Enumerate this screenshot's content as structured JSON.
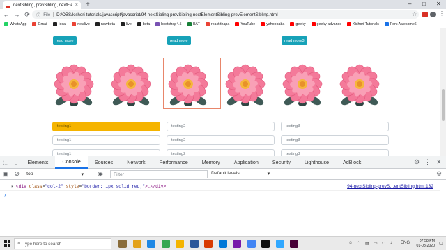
{
  "browser": {
    "tab_title": "nextSibling, prevSibling, nextEle",
    "tab_close": "×",
    "new_tab": "+",
    "minimize": "–",
    "maximize": "□",
    "close": "✕",
    "file_label": "File",
    "url": "D:/OBS/kishori-tutorials/javascript/javascript/94-nextSibling-prevSibling-nextElementSibling-prevElementSibling.html"
  },
  "bookmarks": [
    {
      "label": "WhatsApp",
      "color": "#25d366"
    },
    {
      "label": "Gmail",
      "color": "#ea4335"
    },
    {
      "label": "local",
      "color": "#222222"
    },
    {
      "label": "newlive",
      "color": "#ea4335"
    },
    {
      "label": "newbeta",
      "color": "#222222"
    },
    {
      "label": "live",
      "color": "#222222"
    },
    {
      "label": "beta",
      "color": "#222222"
    },
    {
      "label": "bootstrap4.5",
      "color": "#7952b3"
    },
    {
      "label": "UAT",
      "color": "#188038"
    },
    {
      "label": "react thapa",
      "color": "#ea4335"
    },
    {
      "label": "YouTube",
      "color": "#ff0000"
    },
    {
      "label": "yahoobaba",
      "color": "#ff0000"
    },
    {
      "label": "geeky",
      "color": "#ff0000"
    },
    {
      "label": "geeky advance",
      "color": "#ff0000"
    },
    {
      "label": "Kishori Tutorials",
      "color": "#ff0000"
    },
    {
      "label": "Font Awesome6",
      "color": "#1a73e8"
    }
  ],
  "page": {
    "buttons": [
      "read more",
      "read more",
      "read more3"
    ],
    "inputs_row1": [
      "testing1",
      "testing2",
      "testing3"
    ],
    "inputs_row2": [
      "testing1",
      "testing2",
      "testing3"
    ],
    "inputs_row3": [
      "testing1",
      "testing2",
      "testing3"
    ]
  },
  "devtools": {
    "tabs": [
      "Elements",
      "Console",
      "Sources",
      "Network",
      "Performance",
      "Memory",
      "Application",
      "Security",
      "Lighthouse",
      "AdBlock"
    ],
    "active_tab": "Console",
    "context": "top",
    "filter_placeholder": "Filter",
    "levels": "Default levels",
    "console_output": {
      "expand": "▸",
      "open_tag": "<div",
      "attr1": "class",
      "val1": "\"col-2\"",
      "attr2": "style",
      "val2": "\"border: 1px solid red;\"",
      "rest": ">…</div>",
      "source_link": "94-nextSibling-prevS…entSibling.html:132"
    },
    "prompt": "›"
  },
  "taskbar": {
    "search_placeholder": "Type here to search",
    "lang": "ENG",
    "time": "07:58 PM",
    "date": "01-08-2020",
    "apps": [
      "#8a6d3b",
      "#e3a21a",
      "#1e88e5",
      "#34a853",
      "#f4b400",
      "#2b579a",
      "#d83b01",
      "#0078d7",
      "#7719aa",
      "#4285f4",
      "#101010",
      "#31a8ff",
      "#470137"
    ]
  }
}
